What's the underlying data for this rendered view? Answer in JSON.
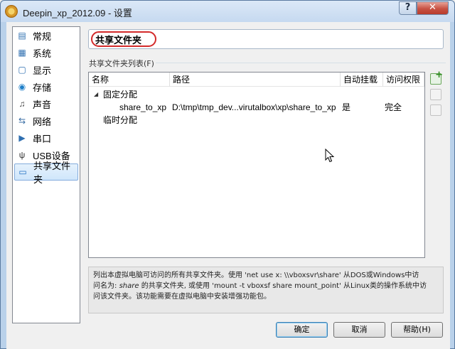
{
  "window": {
    "title": "Deepin_xp_2012.09 - 设置",
    "help_label": "?",
    "close_label": "✕"
  },
  "sidebar": {
    "items": [
      {
        "label": "常规",
        "icon": "general-icon",
        "glyph": "▤",
        "color": "#2f6fb0"
      },
      {
        "label": "系统",
        "icon": "system-icon",
        "glyph": "▦",
        "color": "#2f6fb0"
      },
      {
        "label": "显示",
        "icon": "display-icon",
        "glyph": "▢",
        "color": "#2f6fb0"
      },
      {
        "label": "存储",
        "icon": "storage-icon",
        "glyph": "◉",
        "color": "#1f7fc8"
      },
      {
        "label": "声音",
        "icon": "sound-icon",
        "glyph": "♫",
        "color": "#444444"
      },
      {
        "label": "网络",
        "icon": "network-icon",
        "glyph": "⇆",
        "color": "#3a6ea5"
      },
      {
        "label": "串口",
        "icon": "serial-port-icon",
        "glyph": "▶",
        "color": "#2f6fb0"
      },
      {
        "label": "USB设备",
        "icon": "usb-icon",
        "glyph": "ψ",
        "color": "#333333"
      },
      {
        "label": "共享文件夹",
        "icon": "shared-folder-icon",
        "glyph": "▭",
        "color": "#1f6fc0"
      }
    ],
    "selected_index": 8
  },
  "page": {
    "title": "共享文件夹",
    "list_caption": "共享文件夹列表(F)"
  },
  "table": {
    "columns": [
      "名称",
      "路径",
      "自动挂载",
      "访问权限"
    ],
    "groups": [
      {
        "label": "固定分配",
        "rows": [
          {
            "name": "share_to_xp",
            "path": "D:\\tmp\\tmp_dev...virutalbox\\xp\\share_to_xp",
            "automount": "是",
            "access": "完全"
          }
        ]
      },
      {
        "label": "临时分配",
        "rows": []
      }
    ]
  },
  "info": {
    "line1": "列出本虚拟电脑可访问的所有共享文件夹。使用 'net use x: \\\\vboxsvr\\share' 从DOS或Windows中访",
    "line2_a": "问名为:",
    "line2_em": "share",
    "line2_b": "的共享文件夹, 或使用 'mount -t vboxsf share mount_point' 从Linux类的操作系统中访",
    "line3": "问该文件夹。该功能需要在虚拟电脑中安装增强功能包。"
  },
  "buttons": {
    "ok": "确定",
    "cancel": "取消",
    "help": "帮助(H)"
  }
}
